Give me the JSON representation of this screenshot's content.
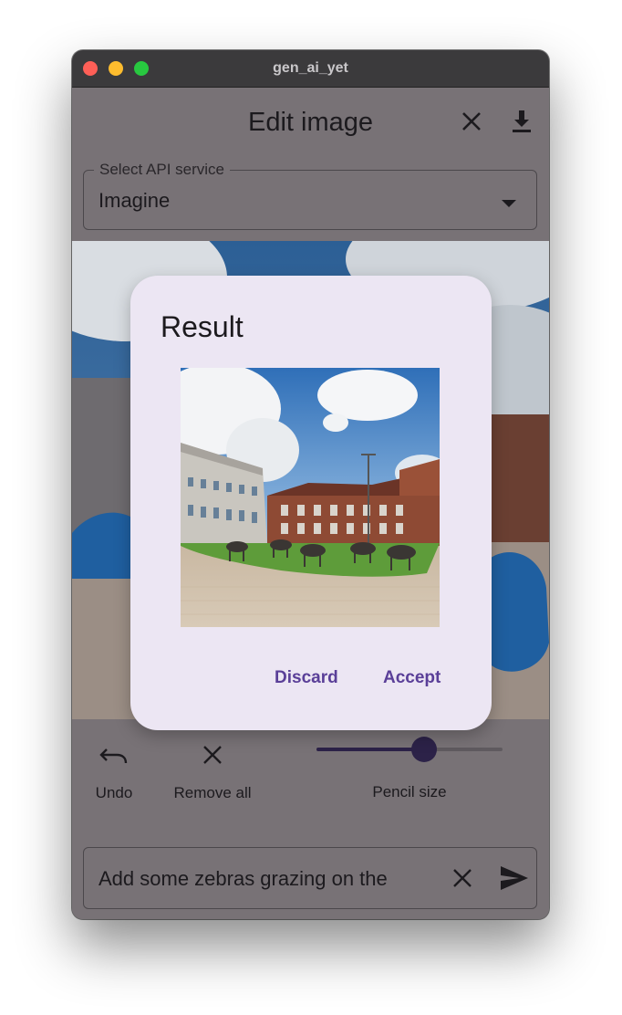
{
  "window": {
    "title": "gen_ai_yet"
  },
  "appbar": {
    "title": "Edit image",
    "close_icon": "close-icon",
    "download_icon": "download-icon"
  },
  "api_select": {
    "label": "Select API service",
    "value": "Imagine"
  },
  "toolbar": {
    "undo_label": "Undo",
    "remove_all_label": "Remove all",
    "pencil_size_label": "Pencil size",
    "pencil_size_fraction": 0.58
  },
  "prompt": {
    "value": "Add some zebras grazing on the"
  },
  "dialog": {
    "title": "Result",
    "discard_label": "Discard",
    "accept_label": "Accept"
  },
  "colors": {
    "accent": "#5a3f98",
    "slider": "#2c2248",
    "mask_blue": "#1f5fa0",
    "dialog_bg": "#ece6f3"
  }
}
